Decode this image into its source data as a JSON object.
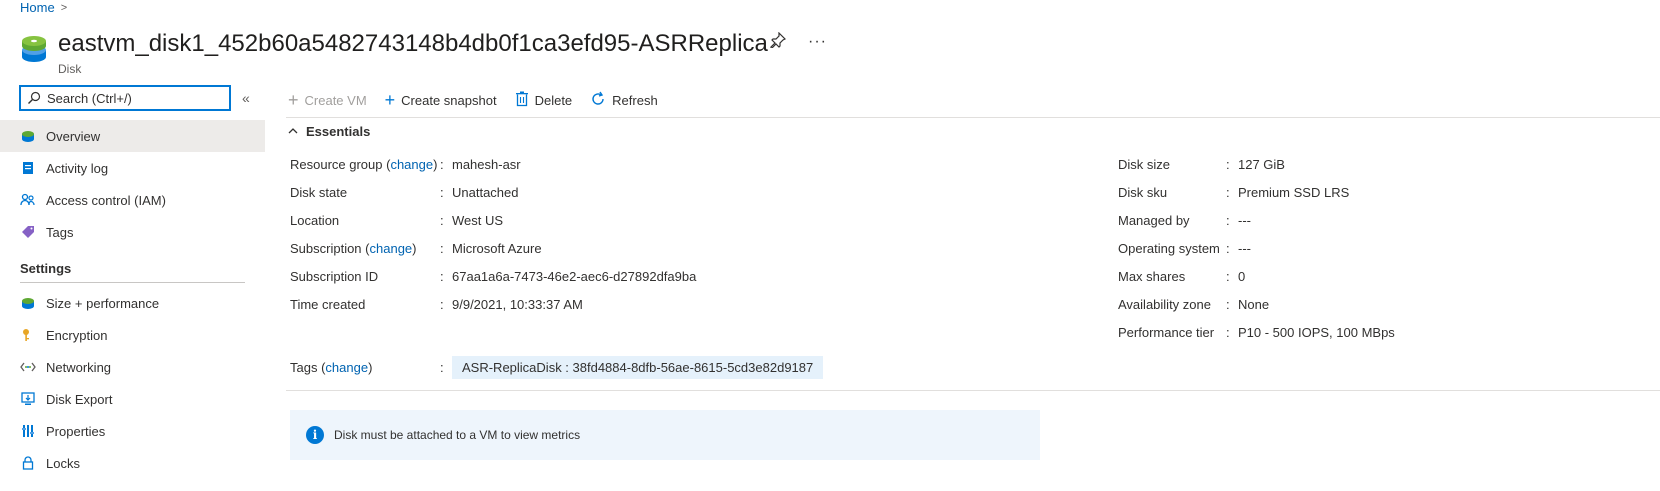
{
  "breadcrumb": {
    "home": "Home",
    "separator": ">"
  },
  "header": {
    "title": "eastvm_disk1_452b60a5482743148b4db0f1ca3efd95-ASRReplica",
    "subtitle": "Disk",
    "pin_icon": "pin-icon",
    "more_icon": "ellipsis-icon"
  },
  "search": {
    "placeholder": "Search (Ctrl+/)",
    "value": ""
  },
  "sidebar": {
    "collapse_label": "«",
    "items": [
      {
        "label": "Overview",
        "icon": "disk-icon",
        "active": true
      },
      {
        "label": "Activity log",
        "icon": "activity-log-icon"
      },
      {
        "label": "Access control (IAM)",
        "icon": "people-icon"
      },
      {
        "label": "Tags",
        "icon": "tag-icon"
      }
    ],
    "settings_header": "Settings",
    "settings_items": [
      {
        "label": "Size + performance",
        "icon": "disk-icon"
      },
      {
        "label": "Encryption",
        "icon": "key-icon"
      },
      {
        "label": "Networking",
        "icon": "network-icon"
      },
      {
        "label": "Disk Export",
        "icon": "export-icon"
      },
      {
        "label": "Properties",
        "icon": "properties-icon"
      },
      {
        "label": "Locks",
        "icon": "lock-icon"
      }
    ]
  },
  "toolbar": {
    "create_vm": "Create VM",
    "create_snapshot": "Create snapshot",
    "delete": "Delete",
    "refresh": "Refresh"
  },
  "essentials": {
    "header": "Essentials",
    "left": [
      {
        "label": "Resource group",
        "change": "change",
        "value": "mahesh-asr",
        "is_link": true
      },
      {
        "label": "Disk state",
        "value": "Unattached"
      },
      {
        "label": "Location",
        "value": "West US"
      },
      {
        "label": "Subscription",
        "change": "change",
        "value": "Microsoft Azure",
        "is_link": true
      },
      {
        "label": "Subscription ID",
        "value": "67aa1a6a-7473-46e2-aec6-d27892dfa9ba"
      },
      {
        "label": "Time created",
        "value": "9/9/2021, 10:33:37 AM"
      }
    ],
    "right": [
      {
        "label": "Disk size",
        "value": "127 GiB"
      },
      {
        "label": "Disk sku",
        "value": "Premium SSD LRS"
      },
      {
        "label": "Managed by",
        "value": "---"
      },
      {
        "label": "Operating system",
        "value": "---"
      },
      {
        "label": "Max shares",
        "value": "0"
      },
      {
        "label": "Availability zone",
        "value": "None"
      },
      {
        "label": "Performance tier",
        "value": "P10 - 500 IOPS, 100 MBps"
      }
    ],
    "tags": {
      "label": "Tags",
      "change": "change",
      "value": "ASR-ReplicaDisk : 38fd4884-8dfb-56ae-8615-5cd3e82d9187"
    },
    "separator": ":"
  },
  "info_banner": {
    "text": "Disk must be attached to a VM to view metrics"
  },
  "colors": {
    "accent": "#0078d4",
    "link": "#0063b1",
    "active_bg": "#edebe9",
    "banner_bg": "#eef5fc"
  }
}
